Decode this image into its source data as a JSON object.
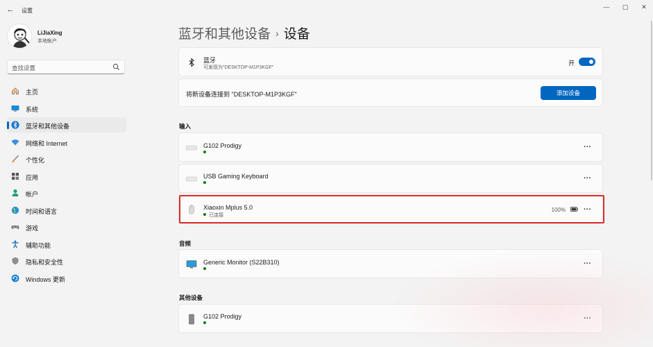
{
  "window": {
    "title": "设置",
    "back_icon": "←",
    "minimize_icon": "—",
    "maximize_icon": "▢",
    "close_icon": "✕"
  },
  "user": {
    "name": "LiJiaXing",
    "account_type": "本地帐户"
  },
  "search": {
    "placeholder": "查找设置"
  },
  "sidebar": {
    "items": [
      {
        "label": "主页",
        "icon": "home-icon"
      },
      {
        "label": "系统",
        "icon": "system-icon"
      },
      {
        "label": "蓝牙和其他设备",
        "icon": "bluetooth-icon",
        "active": true
      },
      {
        "label": "网络和 Internet",
        "icon": "wifi-icon"
      },
      {
        "label": "个性化",
        "icon": "brush-icon"
      },
      {
        "label": "应用",
        "icon": "apps-icon"
      },
      {
        "label": "帐户",
        "icon": "account-icon"
      },
      {
        "label": "时间和语言",
        "icon": "globe-icon"
      },
      {
        "label": "游戏",
        "icon": "gamepad-icon"
      },
      {
        "label": "辅助功能",
        "icon": "accessibility-icon"
      },
      {
        "label": "隐私和安全性",
        "icon": "shield-icon"
      },
      {
        "label": "Windows 更新",
        "icon": "update-icon"
      }
    ]
  },
  "breadcrumb": {
    "parent": "蓝牙和其他设备",
    "separator": "›",
    "current": "设备"
  },
  "bluetooth": {
    "title": "蓝牙",
    "subtitle": "可发现为\"DESKTOP-M1P3KGF\"",
    "toggle_label": "开",
    "toggle_on": true
  },
  "add_device": {
    "text": "将新设备连接到 \"DESKTOP-M1P3KGF\"",
    "button_label": "添加设备"
  },
  "sections": {
    "input": "输入",
    "audio": "音频",
    "other": "其他设备"
  },
  "devices": {
    "input": [
      {
        "name": "G102 Prodigy",
        "status": "",
        "icon": "keyboard-icon"
      },
      {
        "name": "USB Gaming Keyboard",
        "status": "",
        "icon": "keyboard-icon"
      },
      {
        "name": "Xiaoxin Mplus 5.0",
        "status": "已连接",
        "battery": "100%",
        "icon": "mouse-icon"
      }
    ],
    "audio": [
      {
        "name": "Generic Monitor (S22B310)",
        "status": "",
        "icon": "monitor-icon"
      }
    ],
    "other": [
      {
        "name": "G102 Prodigy",
        "status": "",
        "icon": "tower-icon"
      }
    ]
  },
  "more_label": "···",
  "colors": {
    "accent": "#0067c0",
    "connected": "#0f7b0f",
    "highlight": "#e02a2a"
  }
}
